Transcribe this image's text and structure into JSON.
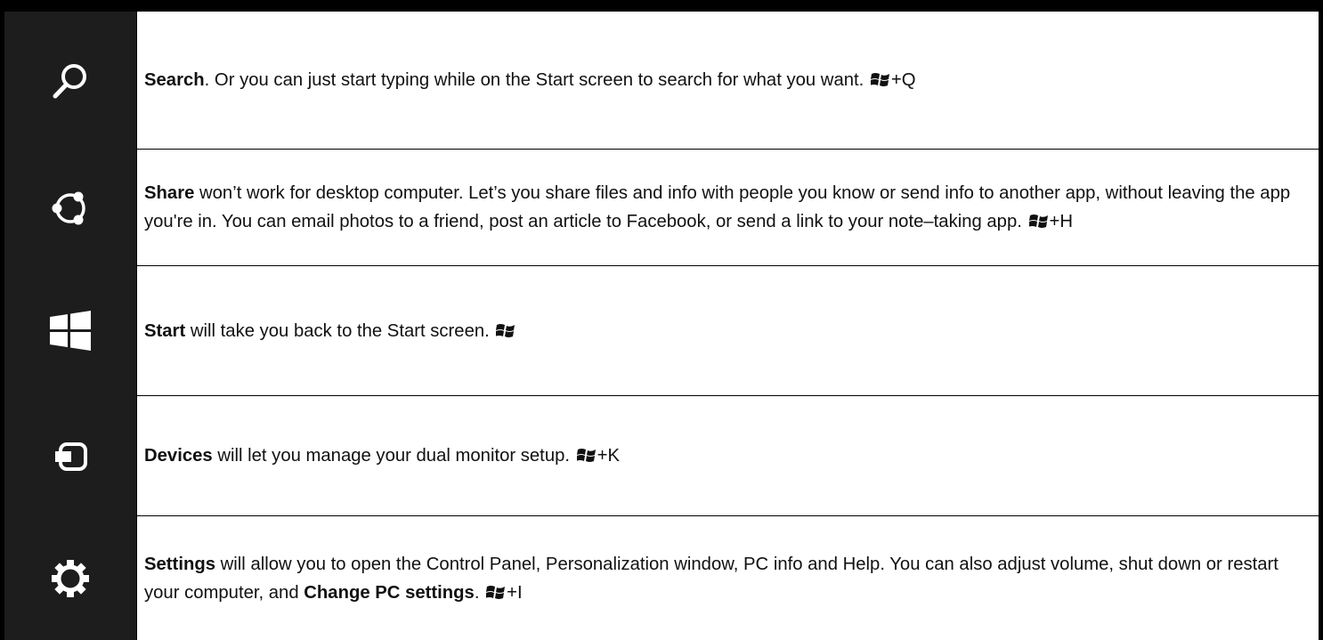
{
  "charms": [
    {
      "icon": "search-icon"
    },
    {
      "icon": "share-icon"
    },
    {
      "icon": "windows-start-icon"
    },
    {
      "icon": "devices-icon"
    },
    {
      "icon": "settings-gear-icon"
    }
  ],
  "rows": [
    {
      "title": "Search",
      "text": ". Or you can just start typing while on the Start screen to search for what you want. ",
      "shortcut": "+Q"
    },
    {
      "title": "Share",
      "text": " won’t work for desktop computer. Let’s you share files and info with people you know or send info to another app, without leaving the app you're in. You can email photos to a friend, post an article to Facebook, or send a link to your note–taking app. ",
      "shortcut": "+H"
    },
    {
      "title": "Start",
      "text": " will take you back to the Start screen. ",
      "shortcut": ""
    },
    {
      "title": "Devices",
      "text": " will let you manage your dual monitor setup.  ",
      "shortcut": "+K"
    },
    {
      "title": "Settings",
      "text": " will allow you to open the Control Panel, Personalization window, PC info and Help. You can also adjust volume, shut down or restart your computer, and ",
      "bold_phrase": "Change PC settings",
      "text_after": ". ",
      "shortcut": "+I"
    }
  ],
  "colors": {
    "charm_bar": "#1d1d1d",
    "icon": "#ffffff",
    "border": "#000000"
  }
}
